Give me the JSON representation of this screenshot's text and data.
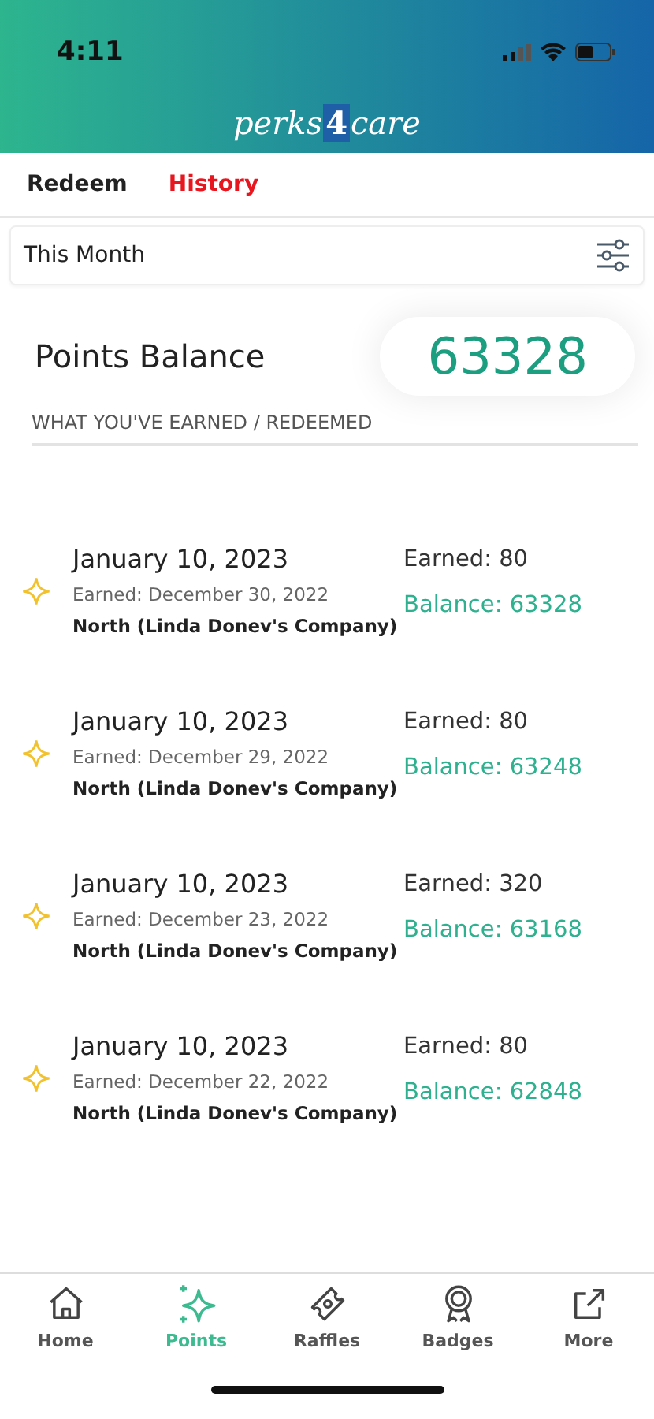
{
  "status_bar": {
    "time": "4:11"
  },
  "header": {
    "logo_left": "perks",
    "logo_mid": "4",
    "logo_right": "care"
  },
  "tabs": [
    {
      "label": "Redeem",
      "selected": false
    },
    {
      "label": "History",
      "selected": true
    }
  ],
  "filter": {
    "value": "This Month"
  },
  "balance": {
    "label": "Points Balance",
    "value": "63328"
  },
  "section_label": "WHAT YOU'VE EARNED / REDEEMED",
  "entries": [
    {
      "date": "January 10, 2023",
      "earned_on": "Earned: December 30, 2022",
      "company": "North (Linda Donev's Company)",
      "amount": "Earned: 80",
      "balance": "Balance: 63328"
    },
    {
      "date": "January 10, 2023",
      "earned_on": "Earned: December 29, 2022",
      "company": "North (Linda Donev's Company)",
      "amount": "Earned: 80",
      "balance": "Balance: 63248"
    },
    {
      "date": "January 10, 2023",
      "earned_on": "Earned: December 23, 2022",
      "company": "North (Linda Donev's Company)",
      "amount": "Earned: 320",
      "balance": "Balance: 63168"
    },
    {
      "date": "January 10, 2023",
      "earned_on": "Earned: December 22, 2022",
      "company": "North (Linda Donev's Company)",
      "amount": "Earned: 80",
      "balance": "Balance: 62848"
    }
  ],
  "nav": [
    {
      "label": "Home",
      "kind": "home",
      "selected": false
    },
    {
      "label": "Points",
      "kind": "points",
      "selected": true
    },
    {
      "label": "Raffles",
      "kind": "raffles",
      "selected": false
    },
    {
      "label": "Badges",
      "kind": "badges",
      "selected": false
    },
    {
      "label": "More",
      "kind": "more",
      "selected": false
    }
  ]
}
